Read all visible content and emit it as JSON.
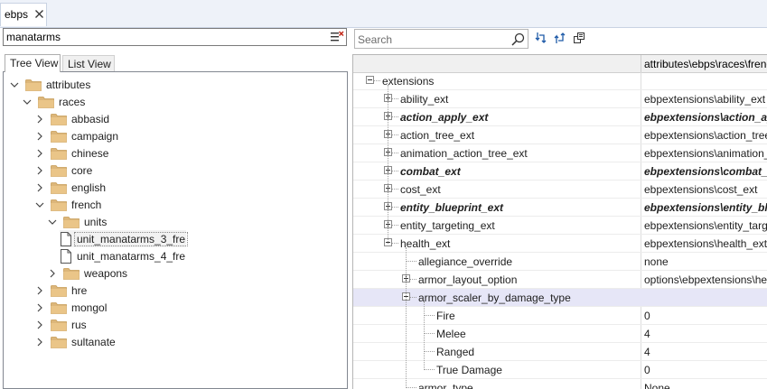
{
  "doc_tab": {
    "label": "ebps"
  },
  "left": {
    "search_value": "manatarms",
    "tabs": [
      {
        "label": "Tree View"
      },
      {
        "label": "List View"
      }
    ],
    "tree": [
      {
        "label": "attributes",
        "level": 0,
        "kind": "folder",
        "expanded": true
      },
      {
        "label": "races",
        "level": 1,
        "kind": "folder",
        "expanded": true
      },
      {
        "label": "abbasid",
        "level": 2,
        "kind": "folder",
        "expanded": false
      },
      {
        "label": "campaign",
        "level": 2,
        "kind": "folder",
        "expanded": false
      },
      {
        "label": "chinese",
        "level": 2,
        "kind": "folder",
        "expanded": false
      },
      {
        "label": "core",
        "level": 2,
        "kind": "folder",
        "expanded": false
      },
      {
        "label": "english",
        "level": 2,
        "kind": "folder",
        "expanded": false
      },
      {
        "label": "french",
        "level": 2,
        "kind": "folder",
        "expanded": true
      },
      {
        "label": "units",
        "level": 3,
        "kind": "folder",
        "expanded": true
      },
      {
        "label": "unit_manatarms_3_fre",
        "level": 4,
        "kind": "file",
        "selected": true
      },
      {
        "label": "unit_manatarms_4_fre",
        "level": 4,
        "kind": "file"
      },
      {
        "label": "weapons",
        "level": 3,
        "kind": "folder",
        "expanded": false
      },
      {
        "label": "hre",
        "level": 2,
        "kind": "folder",
        "expanded": false
      },
      {
        "label": "mongol",
        "level": 2,
        "kind": "folder",
        "expanded": false
      },
      {
        "label": "rus",
        "level": 2,
        "kind": "folder",
        "expanded": false
      },
      {
        "label": "sultanate",
        "level": 2,
        "kind": "folder",
        "expanded": false
      }
    ]
  },
  "right": {
    "search_placeholder": "Search",
    "toolbar_icons": [
      "expand-all-icon",
      "collapse-all-icon",
      "copy-icon"
    ],
    "header_path": "attributes\\ebps\\races\\french",
    "rows": [
      {
        "name": "extensions",
        "value": "",
        "level": 0,
        "expander": "minus",
        "bold": false
      },
      {
        "name": "ability_ext",
        "value": "ebpextensions\\ability_ext",
        "level": 1,
        "expander": "plus",
        "bold": false
      },
      {
        "name": "action_apply_ext",
        "value": "ebpextensions\\action_apply_ext",
        "level": 1,
        "expander": "plus",
        "bold": true
      },
      {
        "name": "action_tree_ext",
        "value": "ebpextensions\\action_tree_ext",
        "level": 1,
        "expander": "plus",
        "bold": false
      },
      {
        "name": "animation_action_tree_ext",
        "value": "ebpextensions\\animation_action_tree_ext",
        "level": 1,
        "expander": "plus",
        "bold": false
      },
      {
        "name": "combat_ext",
        "value": "ebpextensions\\combat_ext",
        "level": 1,
        "expander": "plus",
        "bold": true
      },
      {
        "name": "cost_ext",
        "value": "ebpextensions\\cost_ext",
        "level": 1,
        "expander": "plus",
        "bold": false
      },
      {
        "name": "entity_blueprint_ext",
        "value": "ebpextensions\\entity_blueprint_ext",
        "level": 1,
        "expander": "plus",
        "bold": true
      },
      {
        "name": "entity_targeting_ext",
        "value": "ebpextensions\\entity_targeting_ext",
        "level": 1,
        "expander": "plus",
        "bold": false
      },
      {
        "name": "health_ext",
        "value": "ebpextensions\\health_ext",
        "level": 1,
        "expander": "minus",
        "bold": false
      },
      {
        "name": "allegiance_override",
        "value": "none",
        "level": 2,
        "expander": "none",
        "bold": false
      },
      {
        "name": "armor_layout_option",
        "value": "options\\ebpextensions\\health_ext",
        "level": 2,
        "expander": "plus",
        "bold": false
      },
      {
        "name": "armor_scaler_by_damage_type",
        "value": "",
        "level": 2,
        "expander": "minus",
        "bold": false,
        "highlighted": true
      },
      {
        "name": "Fire",
        "value": "0",
        "level": 3,
        "expander": "none",
        "bold": false
      },
      {
        "name": "Melee",
        "value": "4",
        "level": 3,
        "expander": "none",
        "bold": false
      },
      {
        "name": "Ranged",
        "value": "4",
        "level": 3,
        "expander": "none",
        "bold": false
      },
      {
        "name": "True Damage",
        "value": "0",
        "level": 3,
        "expander": "none",
        "bold": false
      },
      {
        "name": "armor_type",
        "value": "None",
        "level": 2,
        "expander": "none",
        "bold": false
      }
    ]
  }
}
